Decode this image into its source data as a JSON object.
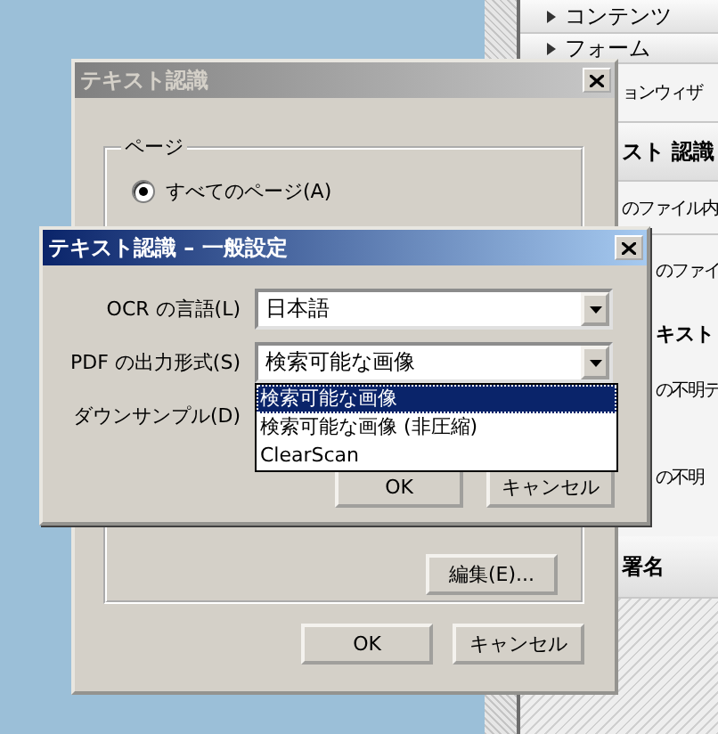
{
  "side_panel": {
    "items": [
      {
        "text": "コンテンツ",
        "kind": "section"
      },
      {
        "text": "フォーム",
        "kind": "section"
      },
      {
        "text": "ョンウィザ",
        "kind": "text"
      },
      {
        "text": "スト 認識",
        "kind": "heading"
      },
      {
        "text": "のファイル内",
        "kind": "text"
      },
      {
        "text": "のファイ",
        "kind": "inset"
      },
      {
        "text": "キスト",
        "kind": "inset_bold"
      },
      {
        "text": "の不明テ",
        "kind": "inset"
      },
      {
        "text": "の不明",
        "kind": "inset"
      },
      {
        "text": "署名",
        "kind": "heading"
      }
    ]
  },
  "back_dialog": {
    "title": "テキスト認識",
    "active": false,
    "group": {
      "label": "ページ",
      "options": [
        {
          "label": "すべてのページ(A)",
          "selected": true
        }
      ]
    },
    "edit_button": "編集(E)...",
    "buttons": [
      "OK",
      "キャンセル"
    ]
  },
  "front_dialog": {
    "title": "テキスト認識 – 一般設定",
    "active": true,
    "fields": [
      {
        "label": "OCR の言語(L)",
        "value": "日本語",
        "expanded": false
      },
      {
        "label": "PDF の出力形式(S)",
        "value": "検索可能な画像",
        "expanded": true,
        "options": [
          {
            "label": "検索可能な画像",
            "selected": true
          },
          {
            "label": "検索可能な画像 (非圧縮)",
            "selected": false
          },
          {
            "label": "ClearScan",
            "selected": false
          }
        ]
      },
      {
        "label": "ダウンサンプル(D)"
      }
    ],
    "buttons": [
      "OK",
      "キャンセル"
    ]
  }
}
